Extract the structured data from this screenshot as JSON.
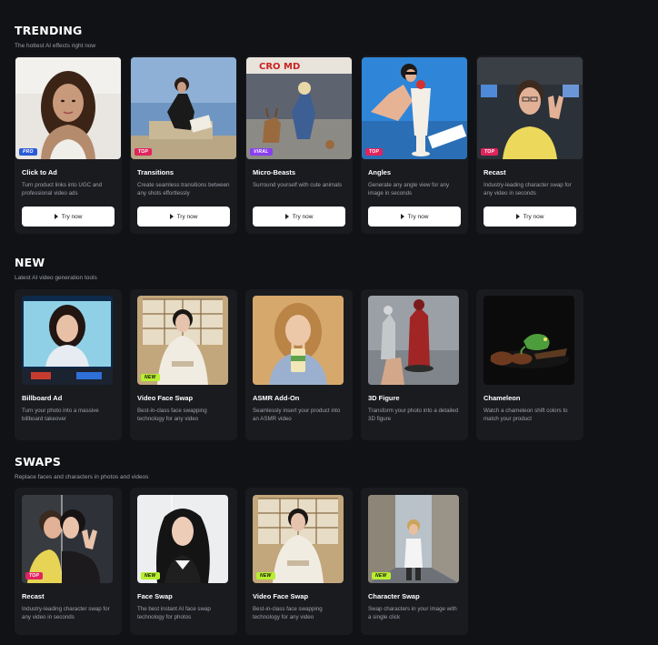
{
  "trending": {
    "title": "TRENDING",
    "subtitle": "The hottest AI effects right now",
    "cards": [
      {
        "title": "Click to Ad",
        "desc": "Turn product links into UGC and professional video ads",
        "badge": "PRO",
        "button": "Try now"
      },
      {
        "title": "Transitions",
        "desc": "Create seamless transitions between any shots effortlessly",
        "badge": "TOP",
        "button": "Try now"
      },
      {
        "title": "Micro-Beasts",
        "desc": "Surround yourself with cute animals",
        "badge": "VIRAL",
        "button": "Try now",
        "sign_text": "CRO MD"
      },
      {
        "title": "Angles",
        "desc": "Generate any angle view for any image in seconds",
        "badge": "TOP",
        "button": "Try now"
      },
      {
        "title": "Recast",
        "desc": "Industry-leading character swap for any video in seconds",
        "badge": "TOP",
        "button": "Try now"
      }
    ]
  },
  "new": {
    "title": "NEW",
    "subtitle": "Latest AI video generation tools",
    "cards": [
      {
        "title": "Billboard Ad",
        "desc": "Turn your photo into a massive billboard takeover",
        "badge": ""
      },
      {
        "title": "Video Face Swap",
        "desc": "Best-in-class face swapping technology for any video",
        "badge": "NEW"
      },
      {
        "title": "ASMR Add-On",
        "desc": "Seamlessly insert your product into an ASMR video",
        "badge": ""
      },
      {
        "title": "3D Figure",
        "desc": "Transform your photo into a detailed 3D figure",
        "badge": ""
      },
      {
        "title": "Chameleon",
        "desc": "Watch a chameleon shift colors to match your product",
        "badge": ""
      }
    ]
  },
  "swaps": {
    "title": "SWAPS",
    "subtitle": "Replace faces and characters in photos and videos",
    "cards": [
      {
        "title": "Recast",
        "desc": "Industry-leading character swap for any video in seconds",
        "badge": "TOP"
      },
      {
        "title": "Face Swap",
        "desc": "The best instant AI face swap technology for photos",
        "badge": "NEW"
      },
      {
        "title": "Video Face Swap",
        "desc": "Best-in-class face swapping technology for any video",
        "badge": "NEW"
      },
      {
        "title": "Character Swap",
        "desc": "Swap characters in your image with a single click",
        "badge": "NEW"
      }
    ]
  },
  "colors": {
    "background": "#111215",
    "card": "#1a1b1f",
    "badge_pro": "#2a5bd7",
    "badge_top": "#e0245e",
    "badge_viral": "#8a3ff0",
    "badge_new": "#b7ef2f"
  }
}
